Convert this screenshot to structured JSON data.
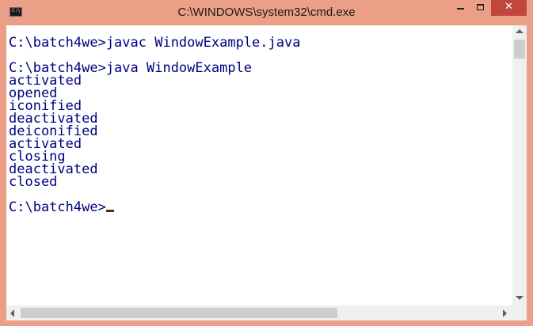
{
  "window": {
    "title": "C:\\WINDOWS\\system32\\cmd.exe",
    "icon_text": "C:\\",
    "close_glyph": "✕",
    "frame_color": "#ea9f86",
    "close_color": "#c0473e",
    "text_color": "#000080"
  },
  "console": {
    "lines": [
      "C:\\batch4we>javac WindowExample.java",
      "",
      "C:\\batch4we>java WindowExample",
      "activated",
      "opened",
      "iconified",
      "deactivated",
      "deiconified",
      "activated",
      "closing",
      "deactivated",
      "closed",
      "",
      "C:\\batch4we>"
    ]
  }
}
